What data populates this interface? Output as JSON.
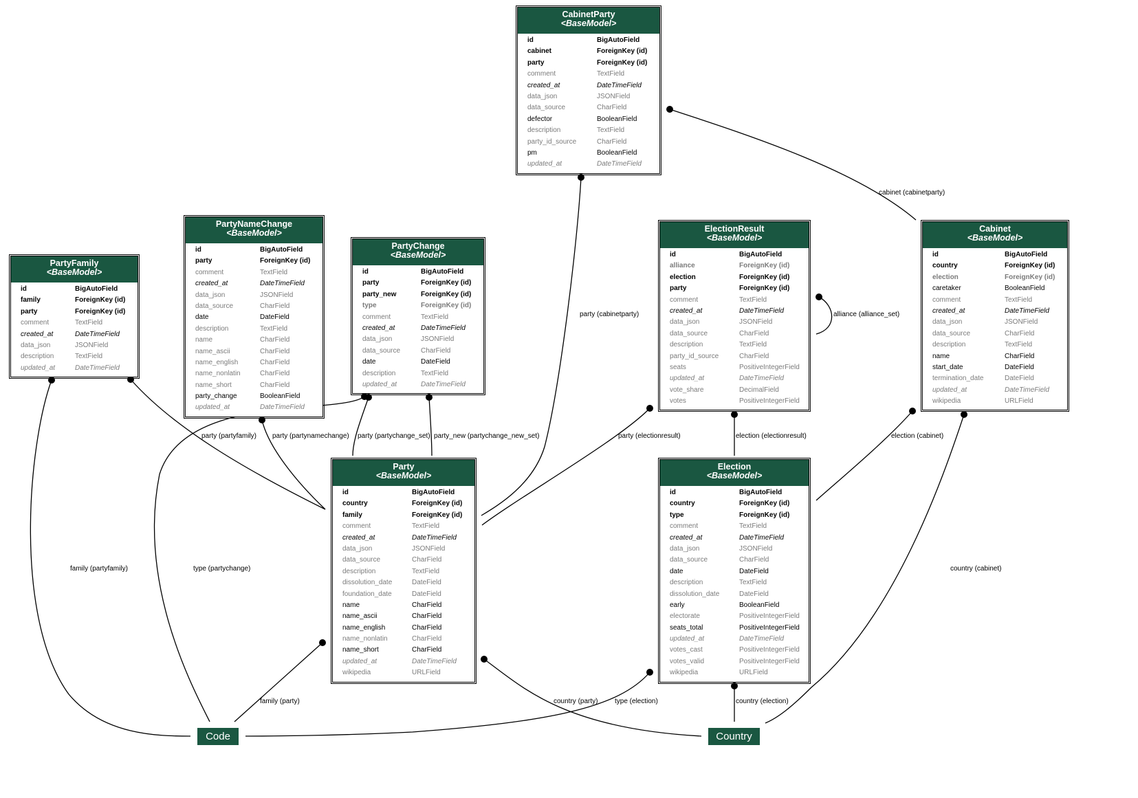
{
  "colors": {
    "header": "#1a5741",
    "edge": "#000000",
    "muted": "#7b7b7b"
  },
  "models": [
    {
      "name": "CabinetParty",
      "base": "<BaseModel>",
      "fields": [
        [
          "id",
          "BigAutoField",
          "b"
        ],
        [
          "cabinet",
          "ForeignKey (id)",
          "b"
        ],
        [
          "party",
          "ForeignKey (id)",
          "b"
        ],
        [
          "comment",
          "TextField",
          "g"
        ],
        [
          "created_at",
          "DateTimeField",
          "i"
        ],
        [
          "data_json",
          "JSONField",
          "g"
        ],
        [
          "data_source",
          "CharField",
          "g"
        ],
        [
          "defector",
          "BooleanField",
          "n"
        ],
        [
          "description",
          "TextField",
          "g"
        ],
        [
          "party_id_source",
          "CharField",
          "g"
        ],
        [
          "pm",
          "BooleanField",
          "n"
        ],
        [
          "updated_at",
          "DateTimeField",
          "ig"
        ]
      ]
    },
    {
      "name": "PartyNameChange",
      "base": "<BaseModel>",
      "fields": [
        [
          "id",
          "BigAutoField",
          "b"
        ],
        [
          "party",
          "ForeignKey (id)",
          "b"
        ],
        [
          "comment",
          "TextField",
          "g"
        ],
        [
          "created_at",
          "DateTimeField",
          "i"
        ],
        [
          "data_json",
          "JSONField",
          "g"
        ],
        [
          "data_source",
          "CharField",
          "g"
        ],
        [
          "date",
          "DateField",
          "n"
        ],
        [
          "description",
          "TextField",
          "g"
        ],
        [
          "name",
          "CharField",
          "g"
        ],
        [
          "name_ascii",
          "CharField",
          "g"
        ],
        [
          "name_english",
          "CharField",
          "g"
        ],
        [
          "name_nonlatin",
          "CharField",
          "g"
        ],
        [
          "name_short",
          "CharField",
          "g"
        ],
        [
          "party_change",
          "BooleanField",
          "n"
        ],
        [
          "updated_at",
          "DateTimeField",
          "ig"
        ]
      ]
    },
    {
      "name": "PartyChange",
      "base": "<BaseModel>",
      "fields": [
        [
          "id",
          "BigAutoField",
          "b"
        ],
        [
          "party",
          "ForeignKey (id)",
          "b"
        ],
        [
          "party_new",
          "ForeignKey (id)",
          "b"
        ],
        [
          "type",
          "ForeignKey (id)",
          "bg"
        ],
        [
          "comment",
          "TextField",
          "g"
        ],
        [
          "created_at",
          "DateTimeField",
          "i"
        ],
        [
          "data_json",
          "JSONField",
          "g"
        ],
        [
          "data_source",
          "CharField",
          "g"
        ],
        [
          "date",
          "DateField",
          "n"
        ],
        [
          "description",
          "TextField",
          "g"
        ],
        [
          "updated_at",
          "DateTimeField",
          "ig"
        ]
      ]
    },
    {
      "name": "PartyFamily",
      "base": "<BaseModel>",
      "fields": [
        [
          "id",
          "BigAutoField",
          "b"
        ],
        [
          "family",
          "ForeignKey (id)",
          "b"
        ],
        [
          "party",
          "ForeignKey (id)",
          "b"
        ],
        [
          "comment",
          "TextField",
          "g"
        ],
        [
          "created_at",
          "DateTimeField",
          "i"
        ],
        [
          "data_json",
          "JSONField",
          "g"
        ],
        [
          "description",
          "TextField",
          "g"
        ],
        [
          "updated_at",
          "DateTimeField",
          "ig"
        ]
      ]
    },
    {
      "name": "ElectionResult",
      "base": "<BaseModel>",
      "fields": [
        [
          "id",
          "BigAutoField",
          "b"
        ],
        [
          "alliance",
          "ForeignKey (id)",
          "bg"
        ],
        [
          "election",
          "ForeignKey (id)",
          "b"
        ],
        [
          "party",
          "ForeignKey (id)",
          "b"
        ],
        [
          "comment",
          "TextField",
          "g"
        ],
        [
          "created_at",
          "DateTimeField",
          "i"
        ],
        [
          "data_json",
          "JSONField",
          "g"
        ],
        [
          "data_source",
          "CharField",
          "g"
        ],
        [
          "description",
          "TextField",
          "g"
        ],
        [
          "party_id_source",
          "CharField",
          "g"
        ],
        [
          "seats",
          "PositiveIntegerField",
          "g"
        ],
        [
          "updated_at",
          "DateTimeField",
          "ig"
        ],
        [
          "vote_share",
          "DecimalField",
          "g"
        ],
        [
          "votes",
          "PositiveIntegerField",
          "g"
        ]
      ]
    },
    {
      "name": "Cabinet",
      "base": "<BaseModel>",
      "fields": [
        [
          "id",
          "BigAutoField",
          "b"
        ],
        [
          "country",
          "ForeignKey (id)",
          "b"
        ],
        [
          "election",
          "ForeignKey (id)",
          "bg"
        ],
        [
          "caretaker",
          "BooleanField",
          "n"
        ],
        [
          "comment",
          "TextField",
          "g"
        ],
        [
          "created_at",
          "DateTimeField",
          "i"
        ],
        [
          "data_json",
          "JSONField",
          "g"
        ],
        [
          "data_source",
          "CharField",
          "g"
        ],
        [
          "description",
          "TextField",
          "g"
        ],
        [
          "name",
          "CharField",
          "n"
        ],
        [
          "start_date",
          "DateField",
          "n"
        ],
        [
          "termination_date",
          "DateField",
          "g"
        ],
        [
          "updated_at",
          "DateTimeField",
          "ig"
        ],
        [
          "wikipedia",
          "URLField",
          "g"
        ]
      ]
    },
    {
      "name": "Party",
      "base": "<BaseModel>",
      "fields": [
        [
          "id",
          "BigAutoField",
          "b"
        ],
        [
          "country",
          "ForeignKey (id)",
          "b"
        ],
        [
          "family",
          "ForeignKey (id)",
          "b"
        ],
        [
          "comment",
          "TextField",
          "g"
        ],
        [
          "created_at",
          "DateTimeField",
          "i"
        ],
        [
          "data_json",
          "JSONField",
          "g"
        ],
        [
          "data_source",
          "CharField",
          "g"
        ],
        [
          "description",
          "TextField",
          "g"
        ],
        [
          "dissolution_date",
          "DateField",
          "g"
        ],
        [
          "foundation_date",
          "DateField",
          "g"
        ],
        [
          "name",
          "CharField",
          "n"
        ],
        [
          "name_ascii",
          "CharField",
          "n"
        ],
        [
          "name_english",
          "CharField",
          "n"
        ],
        [
          "name_nonlatin",
          "CharField",
          "g"
        ],
        [
          "name_short",
          "CharField",
          "n"
        ],
        [
          "updated_at",
          "DateTimeField",
          "ig"
        ],
        [
          "wikipedia",
          "URLField",
          "g"
        ]
      ]
    },
    {
      "name": "Election",
      "base": "<BaseModel>",
      "fields": [
        [
          "id",
          "BigAutoField",
          "b"
        ],
        [
          "country",
          "ForeignKey (id)",
          "b"
        ],
        [
          "type",
          "ForeignKey (id)",
          "b"
        ],
        [
          "comment",
          "TextField",
          "g"
        ],
        [
          "created_at",
          "DateTimeField",
          "i"
        ],
        [
          "data_json",
          "JSONField",
          "g"
        ],
        [
          "data_source",
          "CharField",
          "g"
        ],
        [
          "date",
          "DateField",
          "n"
        ],
        [
          "description",
          "TextField",
          "g"
        ],
        [
          "dissolution_date",
          "DateField",
          "g"
        ],
        [
          "early",
          "BooleanField",
          "n"
        ],
        [
          "electorate",
          "PositiveIntegerField",
          "g"
        ],
        [
          "seats_total",
          "PositiveIntegerField",
          "n"
        ],
        [
          "updated_at",
          "DateTimeField",
          "ig"
        ],
        [
          "votes_cast",
          "PositiveIntegerField",
          "g"
        ],
        [
          "votes_valid",
          "PositiveIntegerField",
          "g"
        ],
        [
          "wikipedia",
          "URLField",
          "g"
        ]
      ]
    }
  ],
  "nodes": [
    {
      "name": "Code"
    },
    {
      "name": "Country"
    }
  ],
  "edges": [
    "party (cabinetparty)",
    "cabinet (cabinetparty)",
    "alliance (alliance_set)",
    "party (electionresult)",
    "election (electionresult)",
    "election (cabinet)",
    "country (cabinet)",
    "family (partyfamily)",
    "party (partyfamily)",
    "party (partynamechange)",
    "type (partychange)",
    "party (partychange_set)",
    "party_new (partychange_new_set)",
    "family (party)",
    "country (party)",
    "type (election)",
    "country (election)"
  ]
}
